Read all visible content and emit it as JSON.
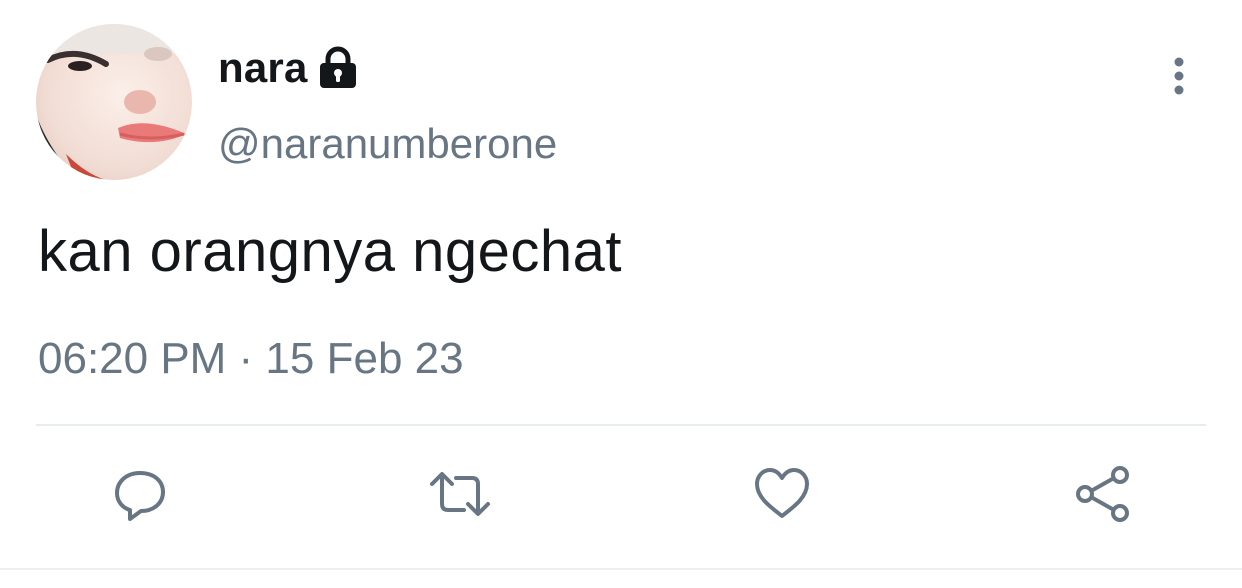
{
  "tweet": {
    "display_name": "nara",
    "handle": "@naranumberone",
    "text": "kan orangnya ngechat",
    "timestamp": "06:20 PM · 15 Feb 23",
    "protected_icon": "lock-icon",
    "avatar": "profile-photo"
  },
  "actions": [
    {
      "name": "reply",
      "icon": "speech-bubble-icon"
    },
    {
      "name": "retweet",
      "icon": "retweet-arrows-icon"
    },
    {
      "name": "like",
      "icon": "heart-icon"
    },
    {
      "name": "share",
      "icon": "share-nodes-icon"
    }
  ],
  "colors": {
    "text": "#14171a",
    "secondary": "#687684",
    "divider": "#e6ecf0"
  }
}
